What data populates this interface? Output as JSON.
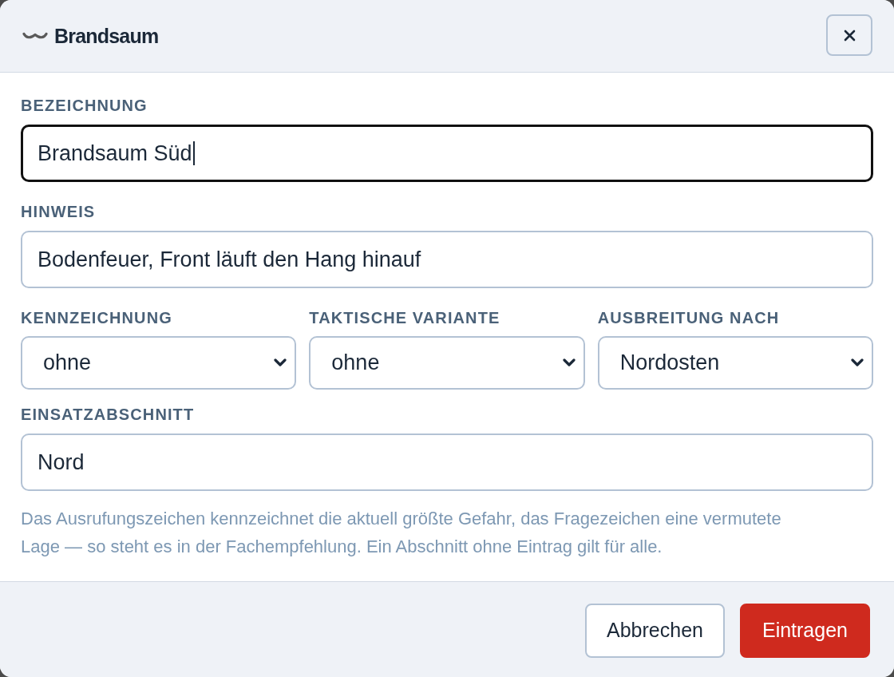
{
  "dialog": {
    "title": "Brandsaum",
    "rows": [
      {
        "fields": [
          {
            "kind": "text",
            "label": "BEZEICHNUNG",
            "value": "Brandsaum Süd",
            "focused": true
          }
        ]
      },
      {
        "fields": [
          {
            "kind": "text",
            "label": "HINWEIS",
            "value": "Bodenfeuer, Front läuft den Hang hinauf",
            "focused": false
          }
        ]
      },
      {
        "fields": [
          {
            "kind": "select",
            "label": "KENNZEICHNUNG",
            "value": "ohne",
            "focused": false
          },
          {
            "kind": "select",
            "label": "TAKTISCHE VARIANTE",
            "value": "ohne",
            "focused": false
          },
          {
            "kind": "select",
            "label": "AUSBREITUNG NACH",
            "value": "Nordosten",
            "focused": false
          }
        ]
      },
      {
        "fields": [
          {
            "kind": "text",
            "label": "EINSATZABSCHNITT",
            "value": "Nord",
            "focused": false
          }
        ]
      }
    ],
    "help_text": "Das Ausrufungszeichen kennzeichnet die aktuell größte Gefahr, das Fragezeichen eine vermutete Lage — so steht es in der Fachempfehlung. Ein Abschnitt ohne Eintrag gilt für alle.",
    "buttons": [
      {
        "kind": "secondary",
        "label": "Abbrechen"
      },
      {
        "kind": "primary",
        "label": "Eintragen"
      }
    ]
  }
}
